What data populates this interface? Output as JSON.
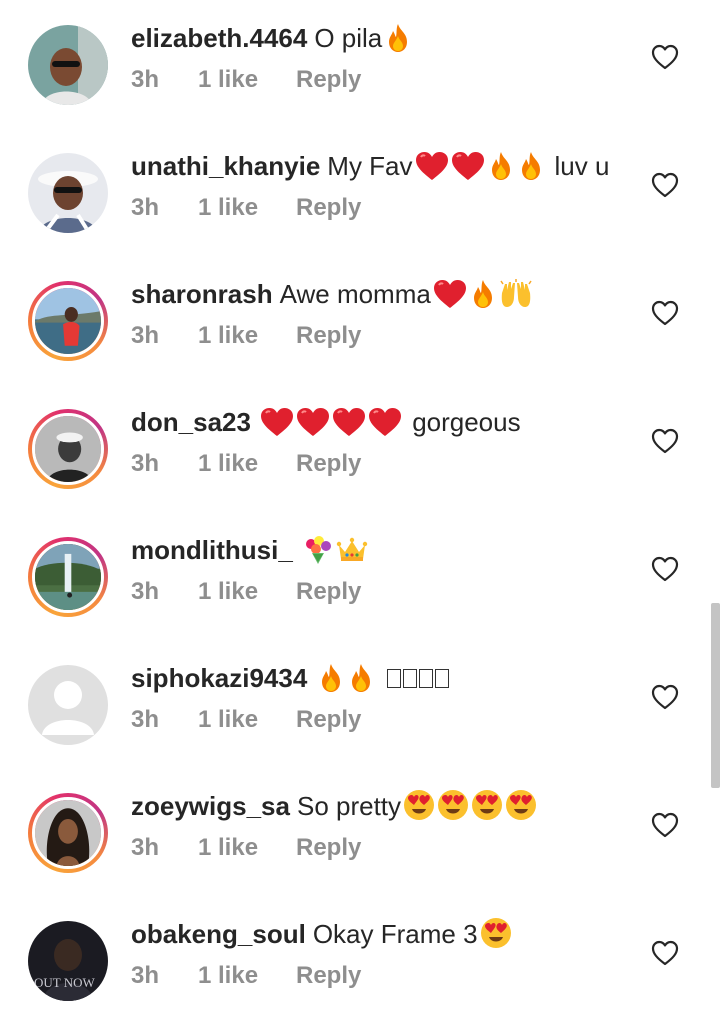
{
  "colors": {
    "text": "#262626",
    "meta": "#8e8e8e",
    "heart_red": "#e0202e",
    "fire": "#f57c00",
    "story_ring": "#f47a3d"
  },
  "comments": [
    {
      "username": "elizabeth.4464",
      "text": "O pila",
      "emoji_after": [
        "fire-icon"
      ],
      "time": "3h",
      "likes": "1 like",
      "reply": "Reply",
      "story_ring": false
    },
    {
      "username": "unathi_khanyie",
      "text": "My Fav",
      "emoji_after": [
        "red-heart-icon",
        "red-heart-icon",
        "fire-icon",
        "fire-icon"
      ],
      "trailing_text": "luv u",
      "time": "3h",
      "likes": "1 like",
      "reply": "Reply",
      "story_ring": false
    },
    {
      "username": "sharonrash",
      "text": "Awe momma",
      "emoji_after": [
        "red-heart-icon",
        "fire-icon",
        "raising-hands-icon"
      ],
      "time": "3h",
      "likes": "1 like",
      "reply": "Reply",
      "story_ring": true
    },
    {
      "username": "don_sa23",
      "text": "",
      "emoji_after": [
        "red-heart-icon",
        "red-heart-icon",
        "red-heart-icon",
        "red-heart-icon"
      ],
      "trailing_text": "gorgeous",
      "time": "3h",
      "likes": "1 like",
      "reply": "Reply",
      "story_ring": true
    },
    {
      "username": "mondlithusi_",
      "text": "",
      "emoji_after": [
        "bouquet-icon",
        "crown-icon"
      ],
      "time": "3h",
      "likes": "1 like",
      "reply": "Reply",
      "story_ring": true
    },
    {
      "username": "siphokazi9434",
      "text": "",
      "emoji_after": [
        "fire-icon",
        "fire-icon"
      ],
      "unrendered_glyphs": 4,
      "time": "3h",
      "likes": "1 like",
      "reply": "Reply",
      "story_ring": false
    },
    {
      "username": "zoeywigs_sa",
      "text": "So pretty",
      "emoji_after": [
        "heart-eyes-icon",
        "heart-eyes-icon",
        "heart-eyes-icon",
        "heart-eyes-icon"
      ],
      "time": "3h",
      "likes": "1 like",
      "reply": "Reply",
      "story_ring": true
    },
    {
      "username": "obakeng_soul",
      "text": "Okay Frame 3",
      "emoji_after": [
        "heart-eyes-icon"
      ],
      "time": "3h",
      "likes": "1 like",
      "reply": "Reply",
      "story_ring": false
    }
  ]
}
